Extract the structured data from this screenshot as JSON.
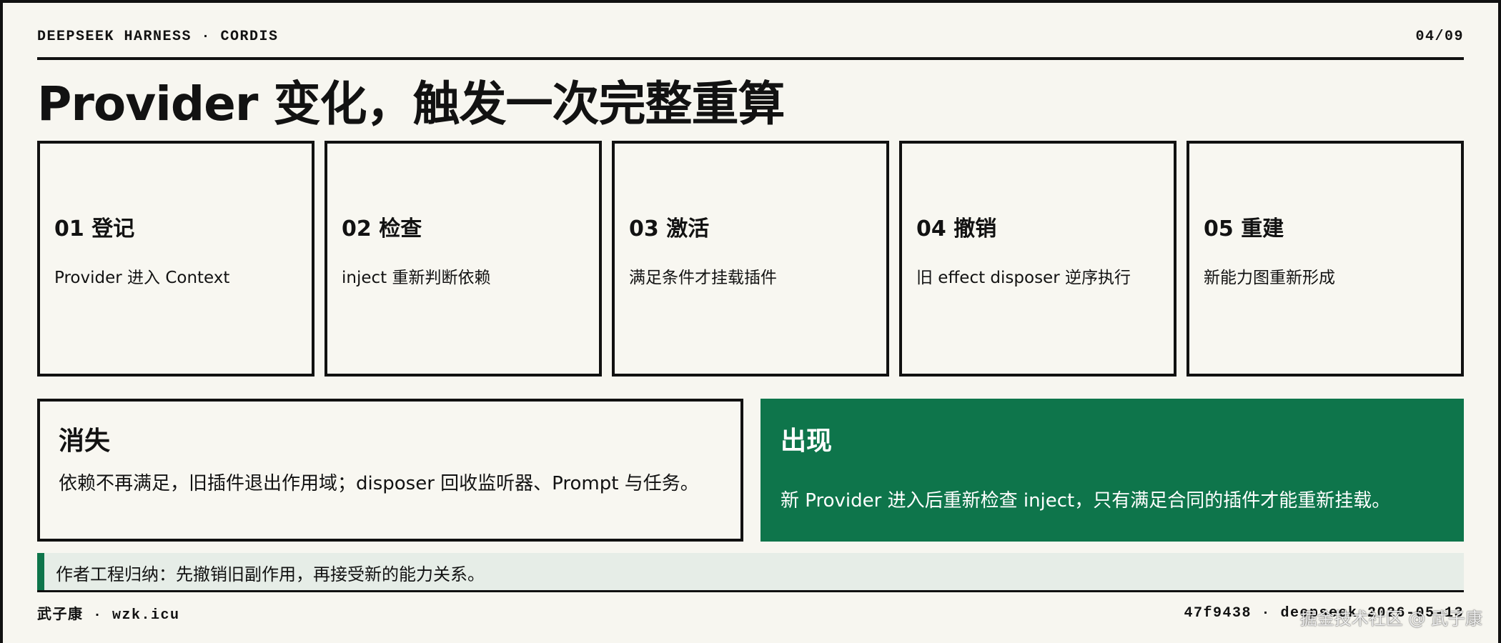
{
  "header": {
    "brand": "DEEPSEEK HARNESS · CORDIS",
    "page": "04/09"
  },
  "title": "Provider 变化，触发一次完整重算",
  "steps": [
    {
      "title": "01 登记",
      "desc": "Provider 进入 Context"
    },
    {
      "title": "02 检查",
      "desc": "inject 重新判断依赖"
    },
    {
      "title": "03 激活",
      "desc": "满足条件才挂载插件"
    },
    {
      "title": "04 撤销",
      "desc": "旧 effect disposer 逆序执行"
    },
    {
      "title": "05 重建",
      "desc": "新能力图重新形成"
    }
  ],
  "panels": {
    "vanish": {
      "title": "消失",
      "text": "依赖不再满足，旧插件退出作用域；disposer 回收监听器、Prompt 与任务。"
    },
    "appear": {
      "title": "出现",
      "text": "新 Provider 进入后重新检查 inject，只有满足合同的插件才能重新挂载。",
      "color": "#0e754b"
    }
  },
  "note": "作者工程归纳：先撤销旧副作用，再接受新的能力关系。",
  "footer": {
    "author": "武子康 · wzk.icu",
    "meta": "47f9438 · deepseek 2026-05-13",
    "watermark": "掘金技术社区 @ 武子康"
  }
}
